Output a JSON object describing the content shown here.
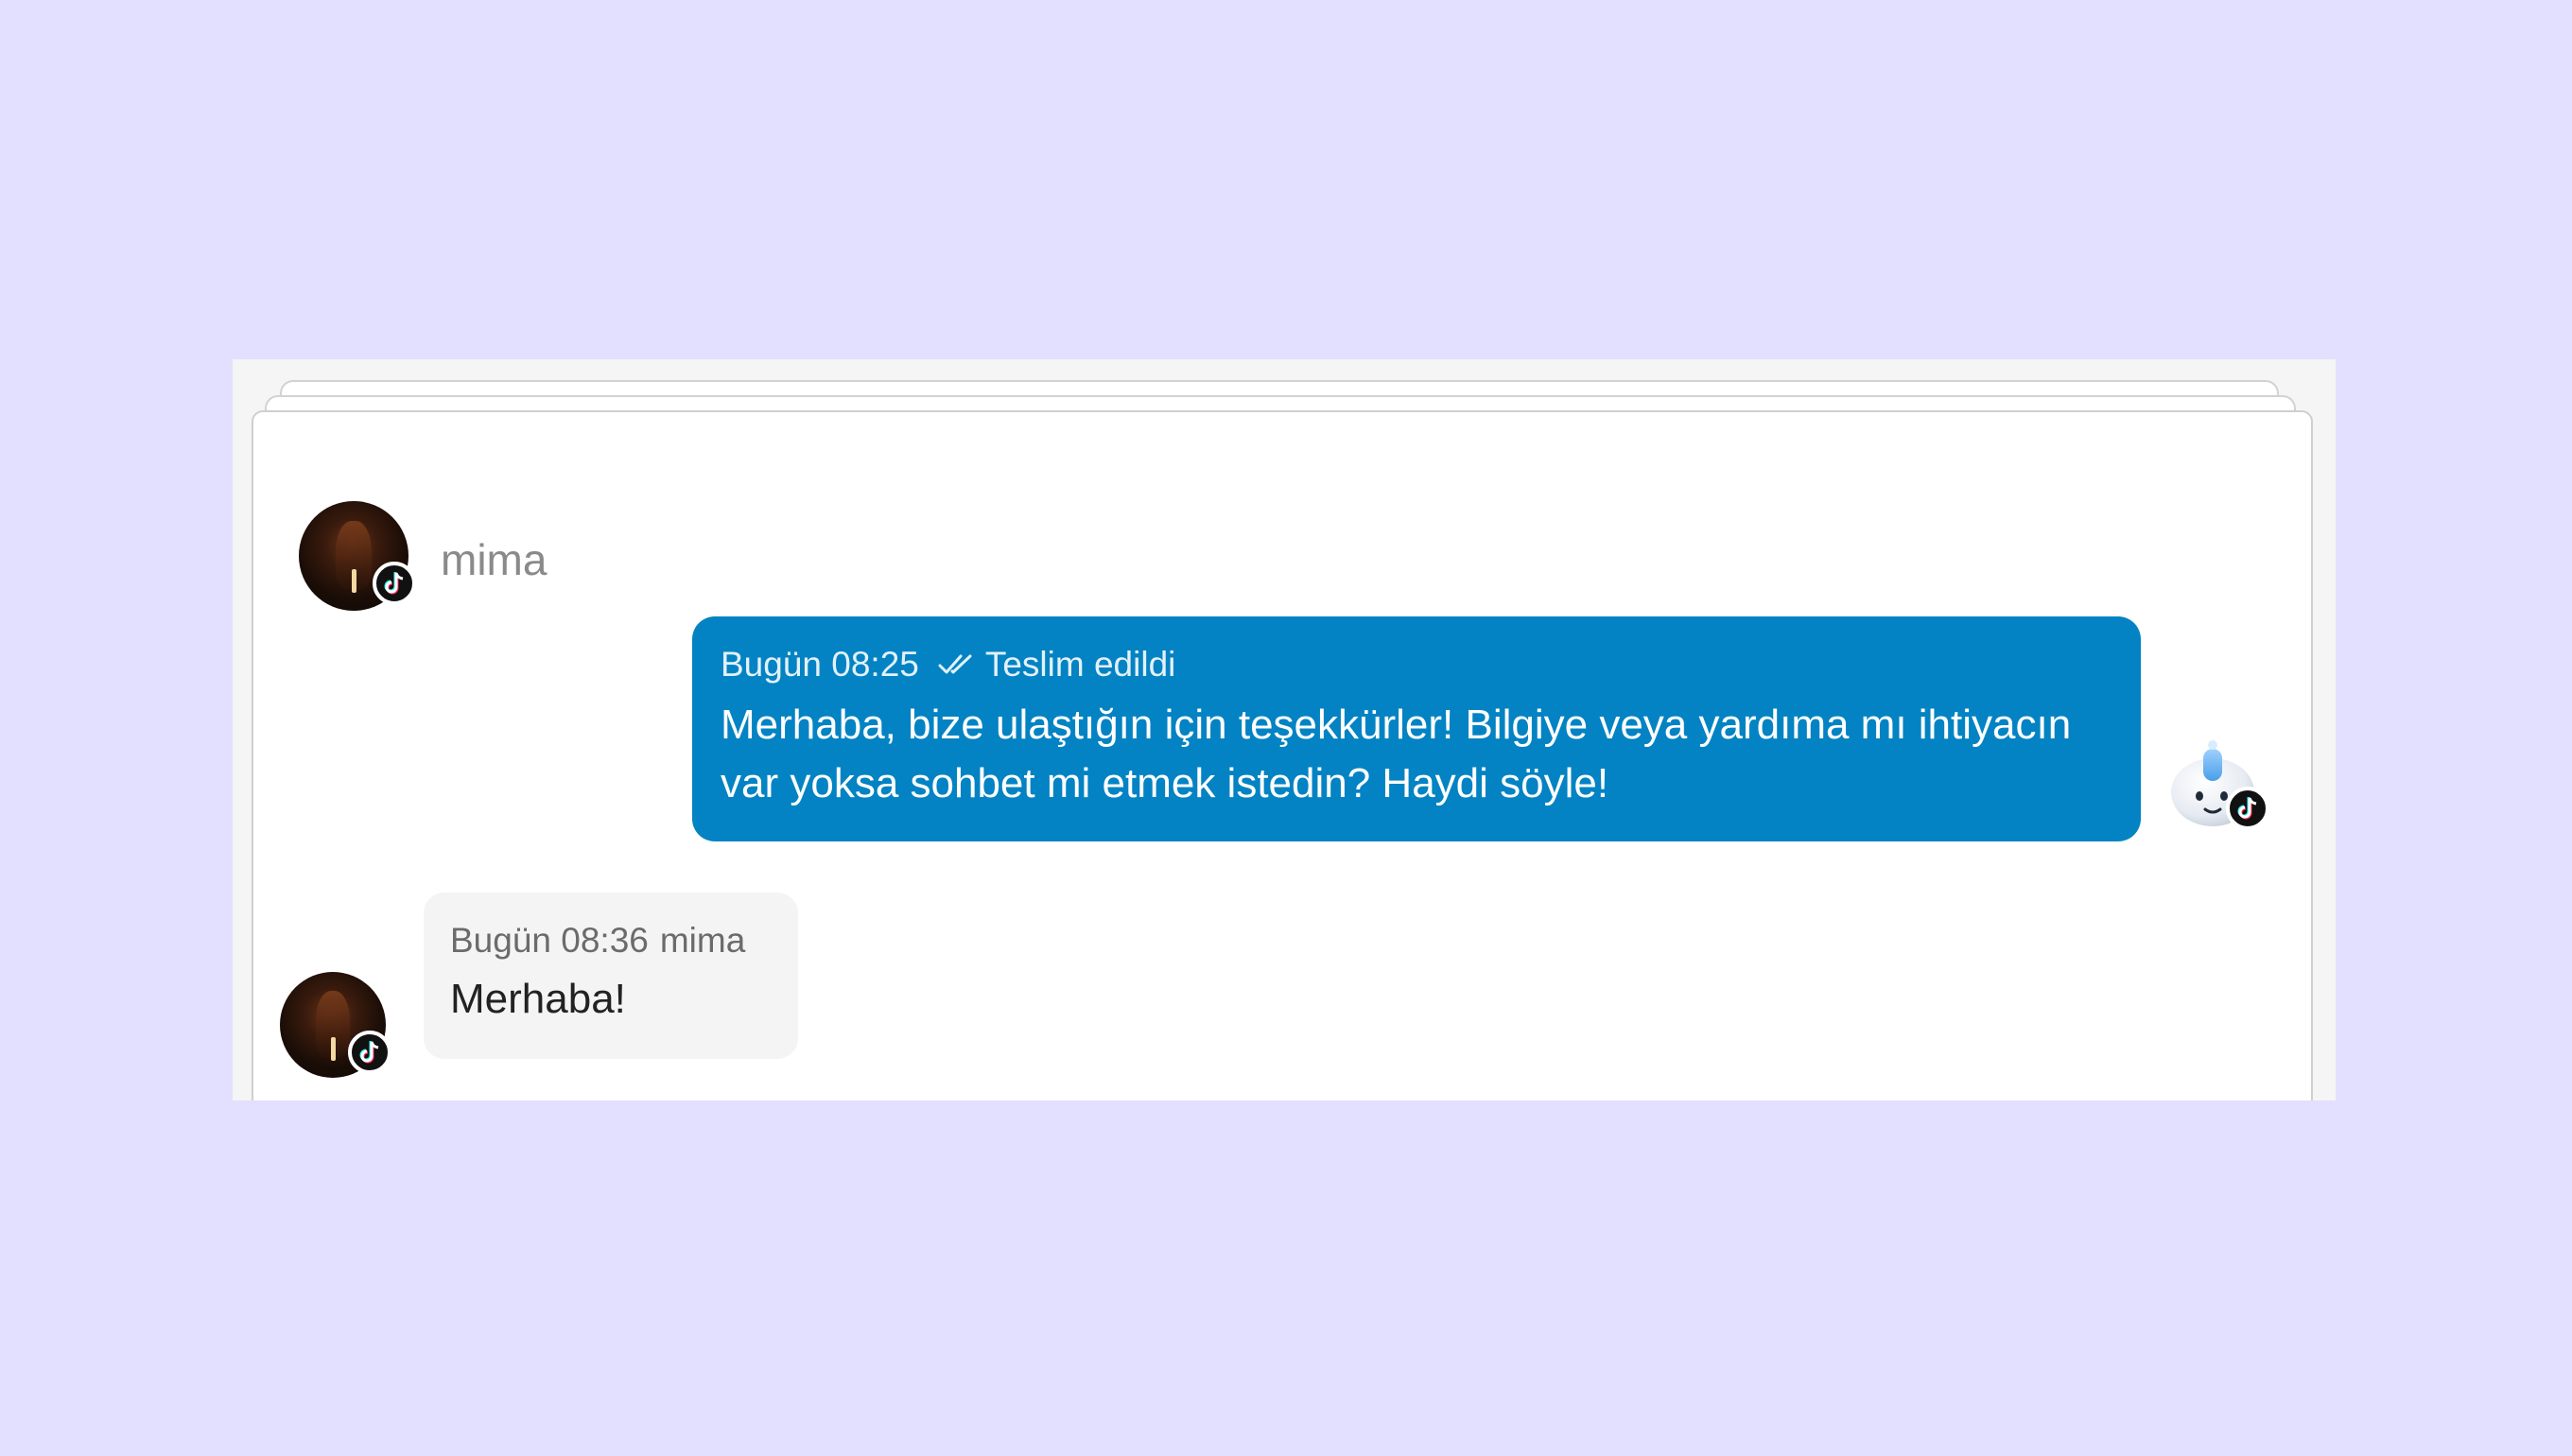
{
  "conversation": {
    "contact_name": "mima",
    "platform_icon": "tiktok-icon",
    "messages": [
      {
        "direction": "outgoing",
        "time": "Bugün 08:25",
        "status_icon": "double-check-icon",
        "status": "Teslim edildi",
        "text": "Merhaba, bize ulaştığın için teşekkürler! Bilgiye veya yardıma mı ihtiyacın\nvar yoksa sohbet mi etmek istedin? Haydi söyle!"
      },
      {
        "direction": "incoming",
        "time": "Bugün 08:36",
        "sender": "mima",
        "text": "Merhaba!"
      }
    ]
  },
  "colors": {
    "page_background": "#e3dffe",
    "outgoing_bubble": "#0383c3",
    "incoming_bubble": "#f4f4f4",
    "contact_name": "#8a8a8a"
  }
}
